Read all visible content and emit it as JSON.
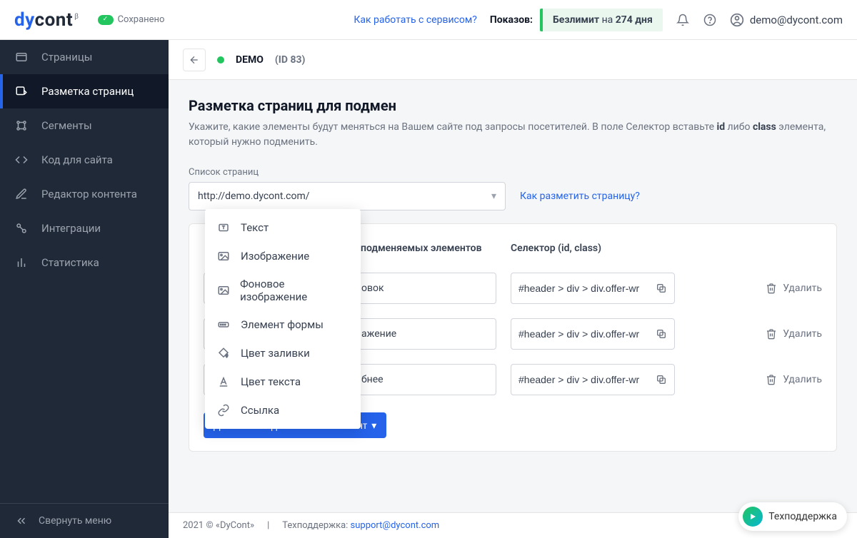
{
  "header": {
    "logo_prefix": "dy",
    "logo_suffix": "cont",
    "logo_beta": "β",
    "saved": "Сохранено",
    "how_link": "Как работать с сервисом?",
    "impressions_label": "Показов:",
    "badge_unlimited": "Безлимит",
    "badge_na": " на ",
    "badge_days": "274 дня",
    "user_email": "demo@dycont.com"
  },
  "sidebar": {
    "items": [
      {
        "label": "Страницы"
      },
      {
        "label": "Разметка страниц"
      },
      {
        "label": "Сегменты"
      },
      {
        "label": "Код для сайта"
      },
      {
        "label": "Редактор контента"
      },
      {
        "label": "Интеграции"
      },
      {
        "label": "Статистика"
      }
    ],
    "collapse": "Свернуть меню"
  },
  "topbar": {
    "project_name": "DEMO",
    "project_id": "(ID 83)"
  },
  "page": {
    "title": "Разметка страниц для подмен",
    "subtitle_a": "Укажите, какие элементы будут меняться на Вашем сайте под запросы посетителей. В поле Селектор вставьте ",
    "subtitle_b": "id",
    "subtitle_c": " либо ",
    "subtitle_d": "class",
    "subtitle_e": " элемента, который нужно подменить.",
    "list_label": "Список страниц",
    "selected_page": "http://demo.dycont.com/",
    "how_markup_link": "Как разметить страницу?",
    "col_name": "подменяемых элементов",
    "col_selector": "Селектор (id, class)",
    "rows": [
      {
        "name_suffix": "овок",
        "selector": "#header > div > div.offer-wr",
        "delete": "Удалить"
      },
      {
        "name_suffix": "ажение",
        "selector": "#header > div > div.offer-wr",
        "delete": "Удалить"
      },
      {
        "name_suffix": "бнее",
        "selector": "#header > div > div.offer-wr",
        "delete": "Удалить"
      }
    ],
    "add_btn": "Добавить подменяемый элемент"
  },
  "dropdown": {
    "items": [
      {
        "label": "Текст"
      },
      {
        "label": "Изображение"
      },
      {
        "label": "Фоновое изображение"
      },
      {
        "label": "Элемент формы"
      },
      {
        "label": "Цвет заливки"
      },
      {
        "label": "Цвет текста"
      },
      {
        "label": "Ссылка"
      }
    ]
  },
  "footer": {
    "copyright": "2021 © «DyCont»",
    "support_label": "Техподдержка: ",
    "support_email": "support@dycont.com"
  },
  "support_widget": "Техподдержка"
}
